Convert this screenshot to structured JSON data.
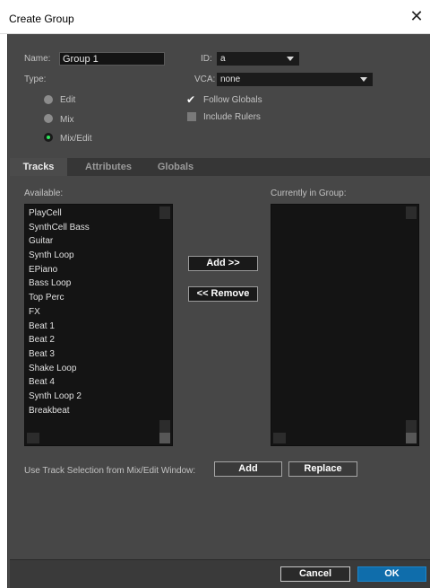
{
  "window": {
    "title": "Create Group",
    "close_glyph": "✕"
  },
  "form": {
    "name_label": "Name:",
    "name_value": "Group 1",
    "id_label": "ID:",
    "id_value": "a",
    "type_label": "Type:",
    "vca_label": "VCA:",
    "vca_value": "none",
    "type_options": [
      {
        "label": "Edit",
        "selected": false
      },
      {
        "label": "Mix",
        "selected": false
      },
      {
        "label": "Mix/Edit",
        "selected": true
      }
    ],
    "follow_globals_label": "Follow Globals",
    "follow_globals_checked": true,
    "include_rulers_label": "Include Rulers",
    "include_rulers_checked": false
  },
  "tabs": [
    {
      "label": "Tracks",
      "active": true
    },
    {
      "label": "Attributes",
      "active": false
    },
    {
      "label": "Globals",
      "active": false
    }
  ],
  "tracks": {
    "available_label": "Available:",
    "current_label": "Currently in Group:",
    "available": [
      "PlayCell",
      "SynthCell Bass",
      "Guitar",
      "Synth Loop",
      "EPiano",
      "Bass Loop",
      "Top Perc",
      "FX",
      "Beat 1",
      "Beat 2",
      "Beat 3",
      "Shake Loop",
      "Beat 4",
      "Synth Loop 2",
      "Breakbeat"
    ],
    "add_label": "Add >>",
    "remove_label": "<< Remove",
    "selection_label": "Use Track Selection from Mix/Edit Window:",
    "sel_add_label": "Add",
    "sel_replace_label": "Replace"
  },
  "footer": {
    "cancel_label": "Cancel",
    "ok_label": "OK"
  },
  "colors": {
    "ok_button": "#0f6dab",
    "radio_on": "#2ee65c",
    "dialog_bg": "#474747"
  },
  "icons": {
    "close": "close-icon",
    "dropdown": "chevron-down-icon",
    "check": "check-icon"
  }
}
